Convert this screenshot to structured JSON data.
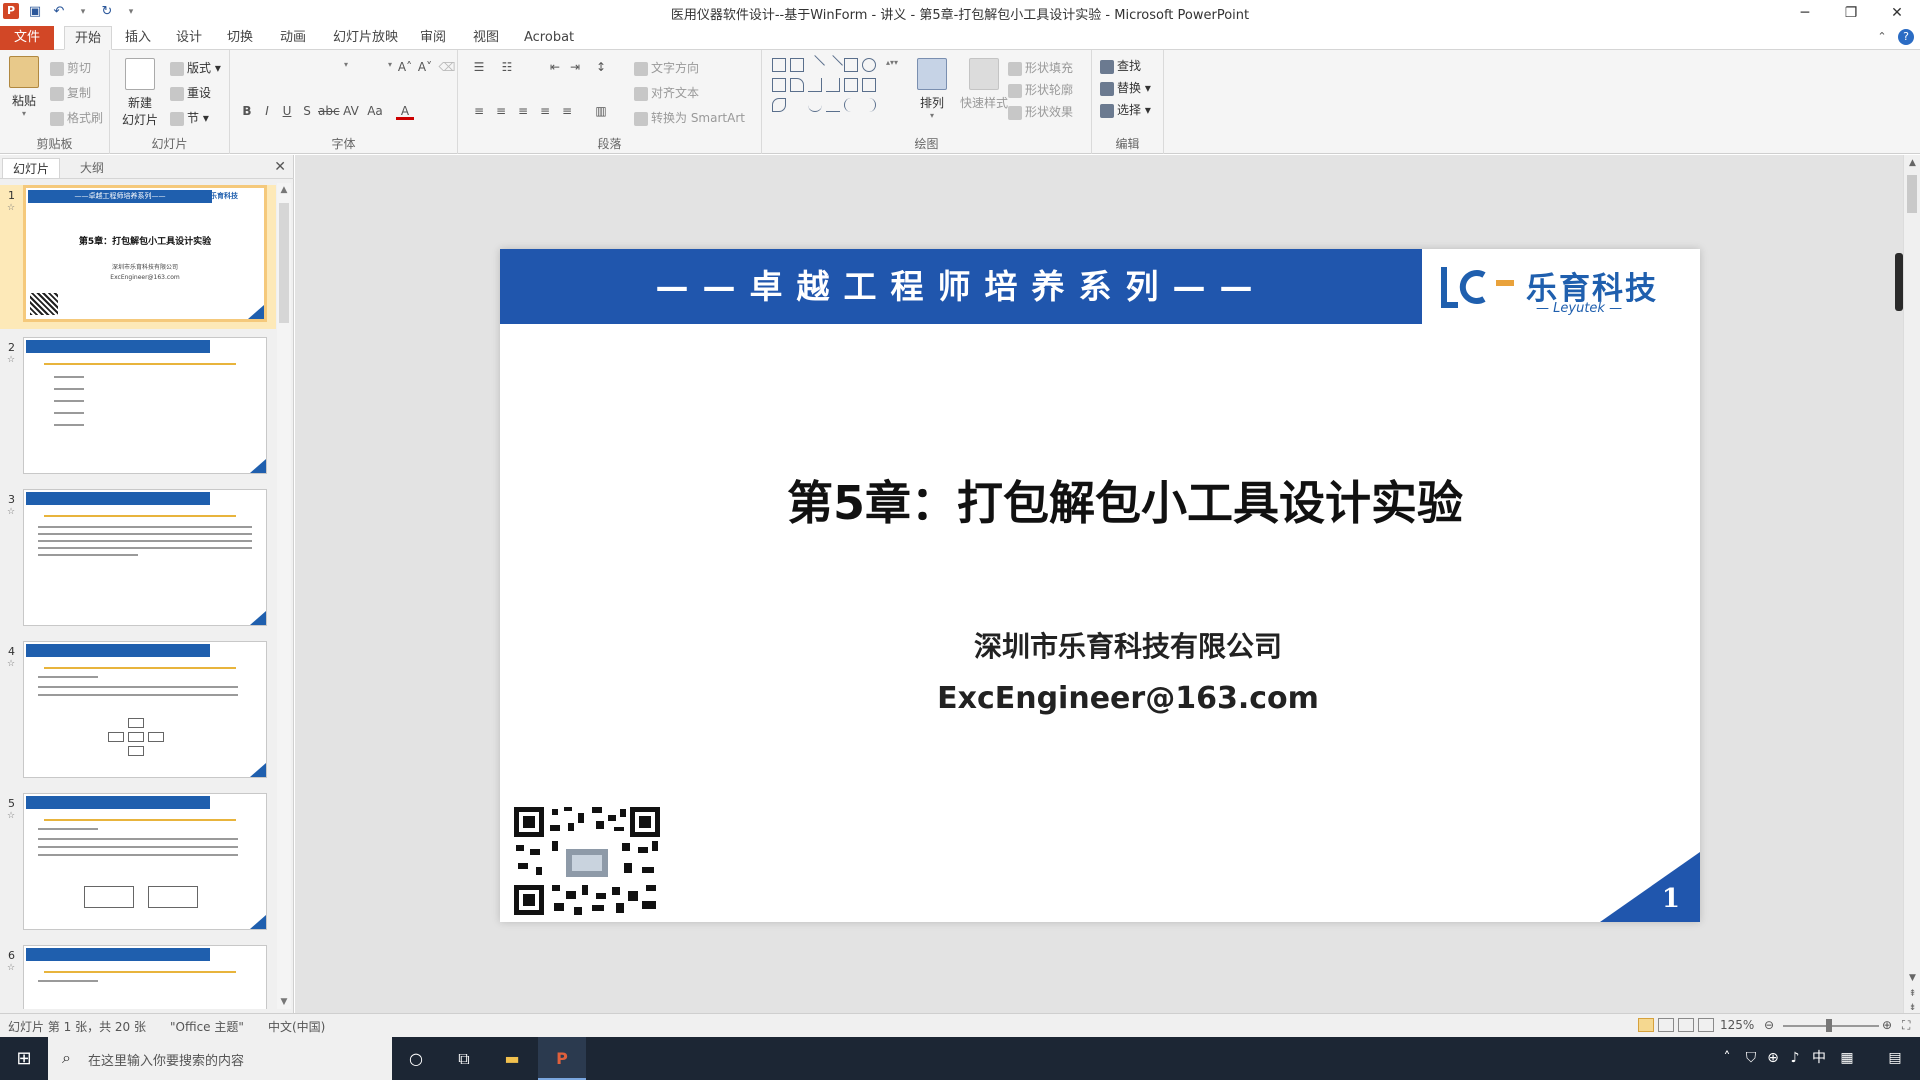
{
  "window": {
    "title": "医用仪器软件设计--基于WinForm - 讲义 - 第5章-打包解包小工具设计实验 - Microsoft PowerPoint",
    "app_icon": "P"
  },
  "qat": {
    "save_icon": "floppy-disk-icon",
    "undo_icon": "undo-icon",
    "redo_icon": "redo-icon"
  },
  "tabs": {
    "file": "文件",
    "home": "开始",
    "insert": "插入",
    "design": "设计",
    "transitions": "切换",
    "animations": "动画",
    "slideshow": "幻灯片放映",
    "review": "审阅",
    "view": "视图",
    "acrobat": "Acrobat"
  },
  "ribbon": {
    "clipboard": {
      "paste": "粘贴",
      "cut": "剪切",
      "copy": "复制",
      "format_painter": "格式刷",
      "label": "剪贴板"
    },
    "slides": {
      "new_slide_1": "新建",
      "new_slide_2": "幻灯片",
      "layout": "版式",
      "reset": "重设",
      "section": "节",
      "label": "幻灯片"
    },
    "font": {
      "label": "字体"
    },
    "paragraph": {
      "text_direction": "文字方向",
      "align_text": "对齐文本",
      "convert_smartart": "转换为 SmartArt",
      "label": "段落"
    },
    "drawing": {
      "arrange": "排列",
      "quick_styles": "快速样式",
      "shape_fill": "形状填充",
      "shape_outline": "形状轮廓",
      "shape_effects": "形状效果",
      "label": "绘图"
    },
    "editing": {
      "find": "查找",
      "replace": "替换",
      "select": "选择",
      "label": "编辑"
    }
  },
  "panel": {
    "tab_slides": "幻灯片",
    "tab_outline": "大纲"
  },
  "thumbnails": [
    {
      "num": "1",
      "selected": true
    },
    {
      "num": "2",
      "selected": false
    },
    {
      "num": "3",
      "selected": false
    },
    {
      "num": "4",
      "selected": false
    },
    {
      "num": "5",
      "selected": false
    },
    {
      "num": "6",
      "selected": false
    }
  ],
  "slide": {
    "header": "——卓越工程师培养系列——",
    "logo_name": "乐育科技",
    "logo_en": "Leyutek",
    "chapter_title": "第5章：打包解包小工具设计实验",
    "company": "深圳市乐育科技有限公司",
    "email": "ExcEngineer@163.com",
    "page_number": "1",
    "brand_color": "#2056ad"
  },
  "statusbar": {
    "slide_info": "幻灯片 第 1 张，共 20 张",
    "theme": "\"Office 主题\"",
    "language": "中文(中国)",
    "zoom": "125%"
  },
  "taskbar": {
    "search_placeholder": "在这里输入你要搜索的内容",
    "ime": "中"
  }
}
